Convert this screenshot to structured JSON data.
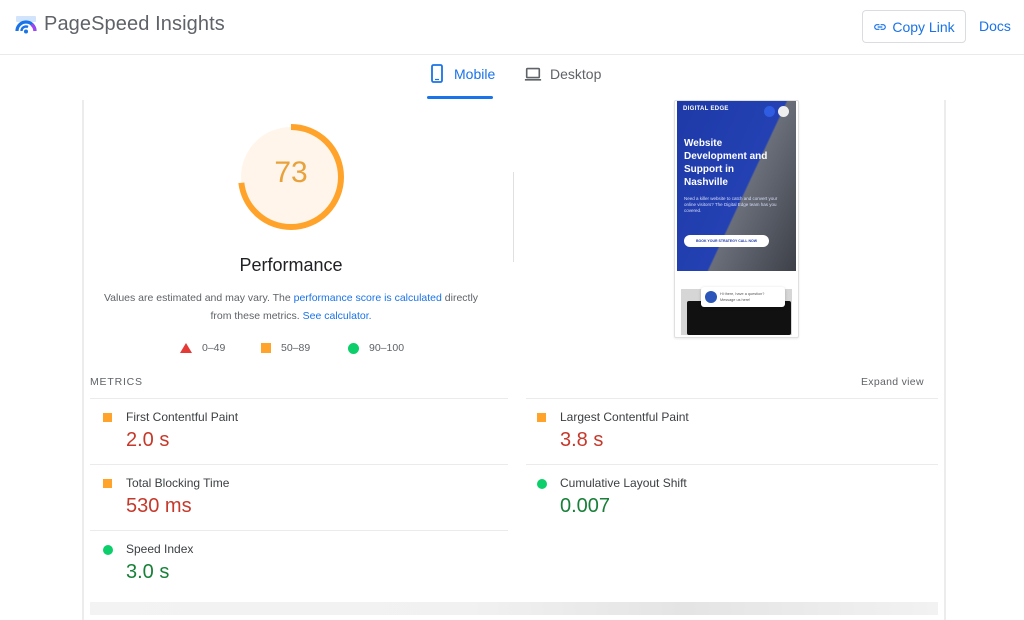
{
  "header": {
    "brand": "PageSpeed Insights",
    "copy_link_label": "Copy Link",
    "docs_label": "Docs"
  },
  "tabs": [
    {
      "label": "Mobile",
      "icon": "phone-icon",
      "active": true
    },
    {
      "label": "Desktop",
      "icon": "laptop-icon",
      "active": false
    }
  ],
  "performance": {
    "score": "73",
    "score_value": 73,
    "title": "Performance",
    "note_prefix": "Values are estimated and may vary. The ",
    "note_link1": "performance score is calculated",
    "note_middle": " directly from these metrics. ",
    "note_link2": "See calculator.",
    "gauge_color": "#ffa32b",
    "gauge_bg": "#fff5ea"
  },
  "legend": [
    {
      "shape": "triangle",
      "label": "0–49",
      "color": "#e53935"
    },
    {
      "shape": "square",
      "label": "50–89",
      "color": "#ffa32b"
    },
    {
      "shape": "circle",
      "label": "90–100",
      "color": "#0cce6b"
    }
  ],
  "thumbnail": {
    "site_logo": "DIGITAL EDGE",
    "headline": "Website Development and Support in Nashville",
    "subtext": "Need a killer website to catch and convert your online visitors? The Digital Edge team has you covered.",
    "cta": "BOOK YOUR STRATEGY CALL NOW",
    "chat_text": "Hi there, have a question? Message us here!"
  },
  "metrics": {
    "section_title": "METRICS",
    "expand_label": "Expand view",
    "items": [
      {
        "name": "First Contentful Paint",
        "value": "2.0 s",
        "rating": "average"
      },
      {
        "name": "Largest Contentful Paint",
        "value": "3.8 s",
        "rating": "average"
      },
      {
        "name": "Total Blocking Time",
        "value": "530 ms",
        "rating": "average"
      },
      {
        "name": "Cumulative Layout Shift",
        "value": "0.007",
        "rating": "good"
      },
      {
        "name": "Speed Index",
        "value": "3.0 s",
        "rating": "good"
      }
    ]
  }
}
